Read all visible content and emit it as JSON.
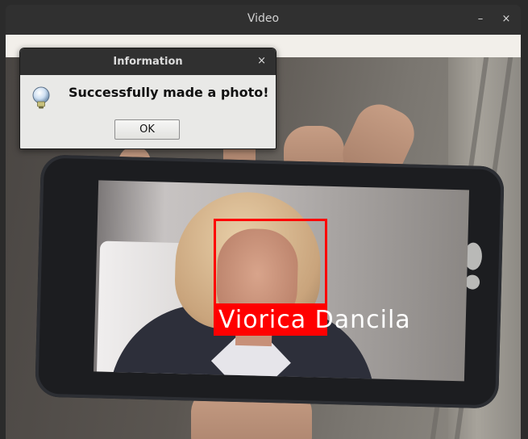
{
  "window": {
    "title": "Video",
    "minimize_glyph": "–",
    "close_glyph": "×"
  },
  "video": {
    "detection": {
      "label": "Viorica Dancila",
      "box_color": "#ff0000",
      "text_color": "#ffffff"
    }
  },
  "dialog": {
    "title": "Information",
    "close_glyph": "×",
    "message": "Successfully made a photo!",
    "ok_label": "OK",
    "icon": "lightbulb-icon"
  }
}
